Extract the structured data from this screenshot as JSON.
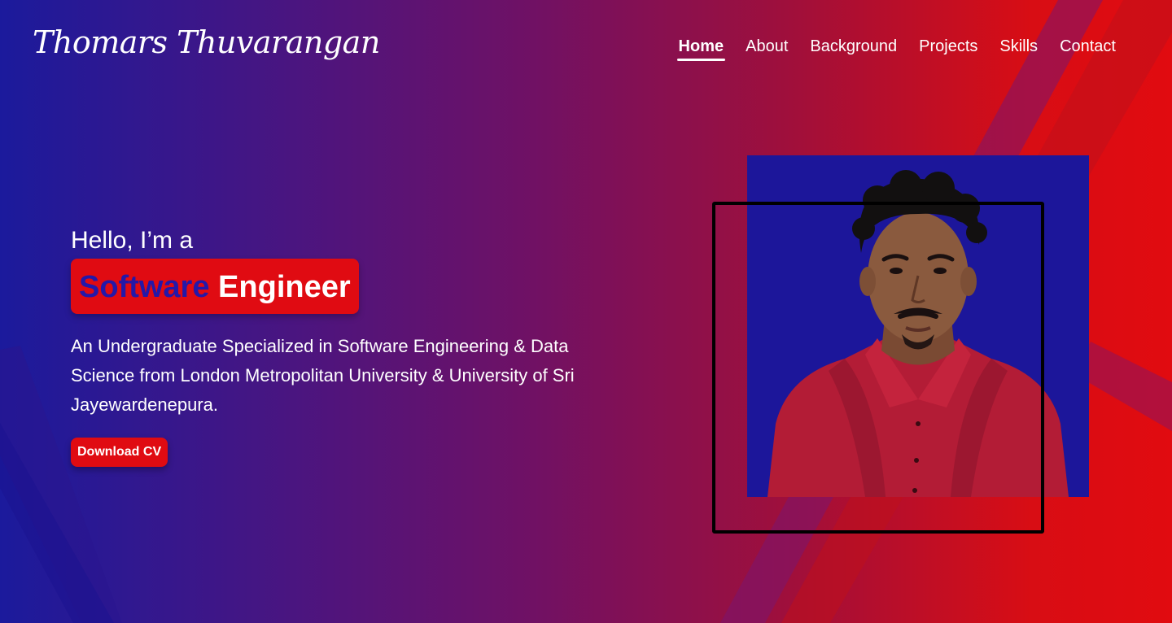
{
  "header": {
    "logo_text": "Thomars Thuvarangan",
    "nav": [
      {
        "label": "Home",
        "active": true
      },
      {
        "label": "About",
        "active": false
      },
      {
        "label": "Background",
        "active": false
      },
      {
        "label": "Projects",
        "active": false
      },
      {
        "label": "Skills",
        "active": false
      },
      {
        "label": "Contact",
        "active": false
      }
    ]
  },
  "hero": {
    "greeting": "Hello, I’m a",
    "role_part1": "Software",
    "role_part2": "Engineer",
    "description": "An Undergraduate Specialized in Software Engineering & Data Science from London Metropolitan University & University of Sri Jayewardenepura.",
    "cv_button_label": "Download CV"
  },
  "colors": {
    "accent_red": "#e00b12",
    "accent_blue": "#2418a8",
    "photo_bg": "#1c169a"
  }
}
